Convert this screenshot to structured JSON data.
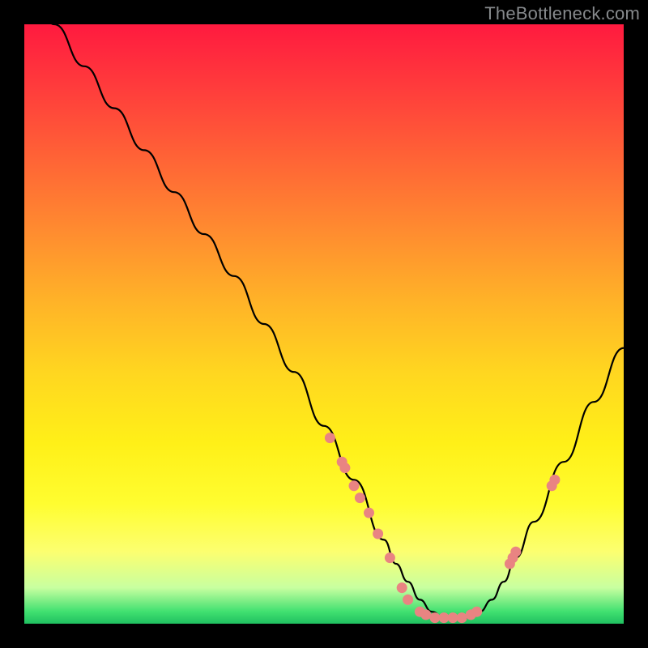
{
  "watermark": "TheBottleneck.com",
  "colors": {
    "background": "#000000",
    "dot": "#e98482",
    "curve": "#000000"
  },
  "chart_data": {
    "type": "line",
    "title": "",
    "xlabel": "",
    "ylabel": "",
    "xlim": [
      0,
      100
    ],
    "ylim": [
      0,
      100
    ],
    "annotations": [],
    "series": [
      {
        "name": "bottleneck-curve",
        "x": [
          0,
          5,
          10,
          15,
          20,
          25,
          30,
          35,
          40,
          45,
          50,
          55,
          60,
          62,
          64,
          66,
          68,
          70,
          72,
          74,
          76,
          78,
          80,
          82,
          85,
          90,
          95,
          100
        ],
        "values": [
          110,
          100,
          93,
          86,
          79,
          72,
          65,
          58,
          50,
          42,
          33,
          24,
          14,
          10,
          7,
          4,
          2,
          1,
          1,
          1,
          2,
          4,
          7,
          11,
          17,
          27,
          37,
          46
        ]
      }
    ],
    "points": [
      {
        "x": 51,
        "y": 31
      },
      {
        "x": 53,
        "y": 27
      },
      {
        "x": 53.5,
        "y": 26
      },
      {
        "x": 55,
        "y": 23
      },
      {
        "x": 56,
        "y": 21
      },
      {
        "x": 57.5,
        "y": 18.5
      },
      {
        "x": 59,
        "y": 15
      },
      {
        "x": 61,
        "y": 11
      },
      {
        "x": 63,
        "y": 6
      },
      {
        "x": 64,
        "y": 4
      },
      {
        "x": 66,
        "y": 2
      },
      {
        "x": 67,
        "y": 1.5
      },
      {
        "x": 68.5,
        "y": 1
      },
      {
        "x": 70,
        "y": 1
      },
      {
        "x": 71.5,
        "y": 1
      },
      {
        "x": 73,
        "y": 1
      },
      {
        "x": 74.5,
        "y": 1.5
      },
      {
        "x": 75.5,
        "y": 2
      },
      {
        "x": 81,
        "y": 10
      },
      {
        "x": 81.5,
        "y": 11
      },
      {
        "x": 82,
        "y": 12
      },
      {
        "x": 88,
        "y": 23
      },
      {
        "x": 88.5,
        "y": 24
      }
    ]
  }
}
